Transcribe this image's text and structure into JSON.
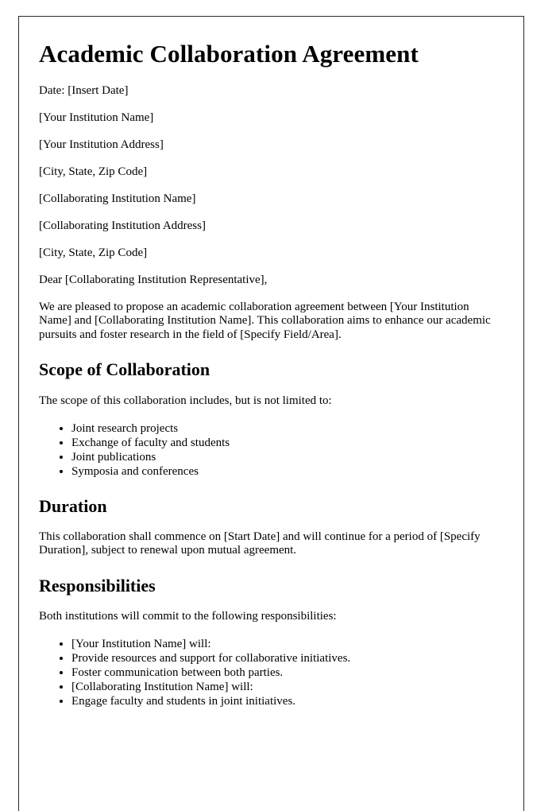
{
  "document": {
    "title": "Academic Collaboration Agreement",
    "date_line": "Date: [Insert Date]",
    "sender_address": [
      "[Your Institution Name]",
      "[Your Institution Address]",
      "[City, State, Zip Code]"
    ],
    "recipient_address": [
      "[Collaborating Institution Name]",
      "[Collaborating Institution Address]",
      "[City, State, Zip Code]"
    ],
    "salutation": "Dear [Collaborating Institution Representative],",
    "intro_paragraph": "We are pleased to propose an academic collaboration agreement between [Your Institution Name] and [Collaborating Institution Name]. This collaboration aims to enhance our academic pursuits and foster research in the field of [Specify Field/Area].",
    "sections": [
      {
        "heading": "Scope of Collaboration",
        "intro": "The scope of this collaboration includes, but is not limited to:",
        "items": [
          "Joint research projects",
          "Exchange of faculty and students",
          "Joint publications",
          "Symposia and conferences"
        ]
      },
      {
        "heading": "Duration",
        "intro": "This collaboration shall commence on [Start Date] and will continue for a period of [Specify Duration], subject to renewal upon mutual agreement.",
        "items": []
      },
      {
        "heading": "Responsibilities",
        "intro": "Both institutions will commit to the following responsibilities:",
        "items": [
          "[Your Institution Name] will:",
          "Provide resources and support for collaborative initiatives.",
          "Foster communication between both parties.",
          "[Collaborating Institution Name] will:",
          "Engage faculty and students in joint initiatives."
        ]
      }
    ]
  },
  "style": {
    "page_border_color": "#2b2b2b",
    "page_background": "#ffffff",
    "text_color": "#000000"
  }
}
